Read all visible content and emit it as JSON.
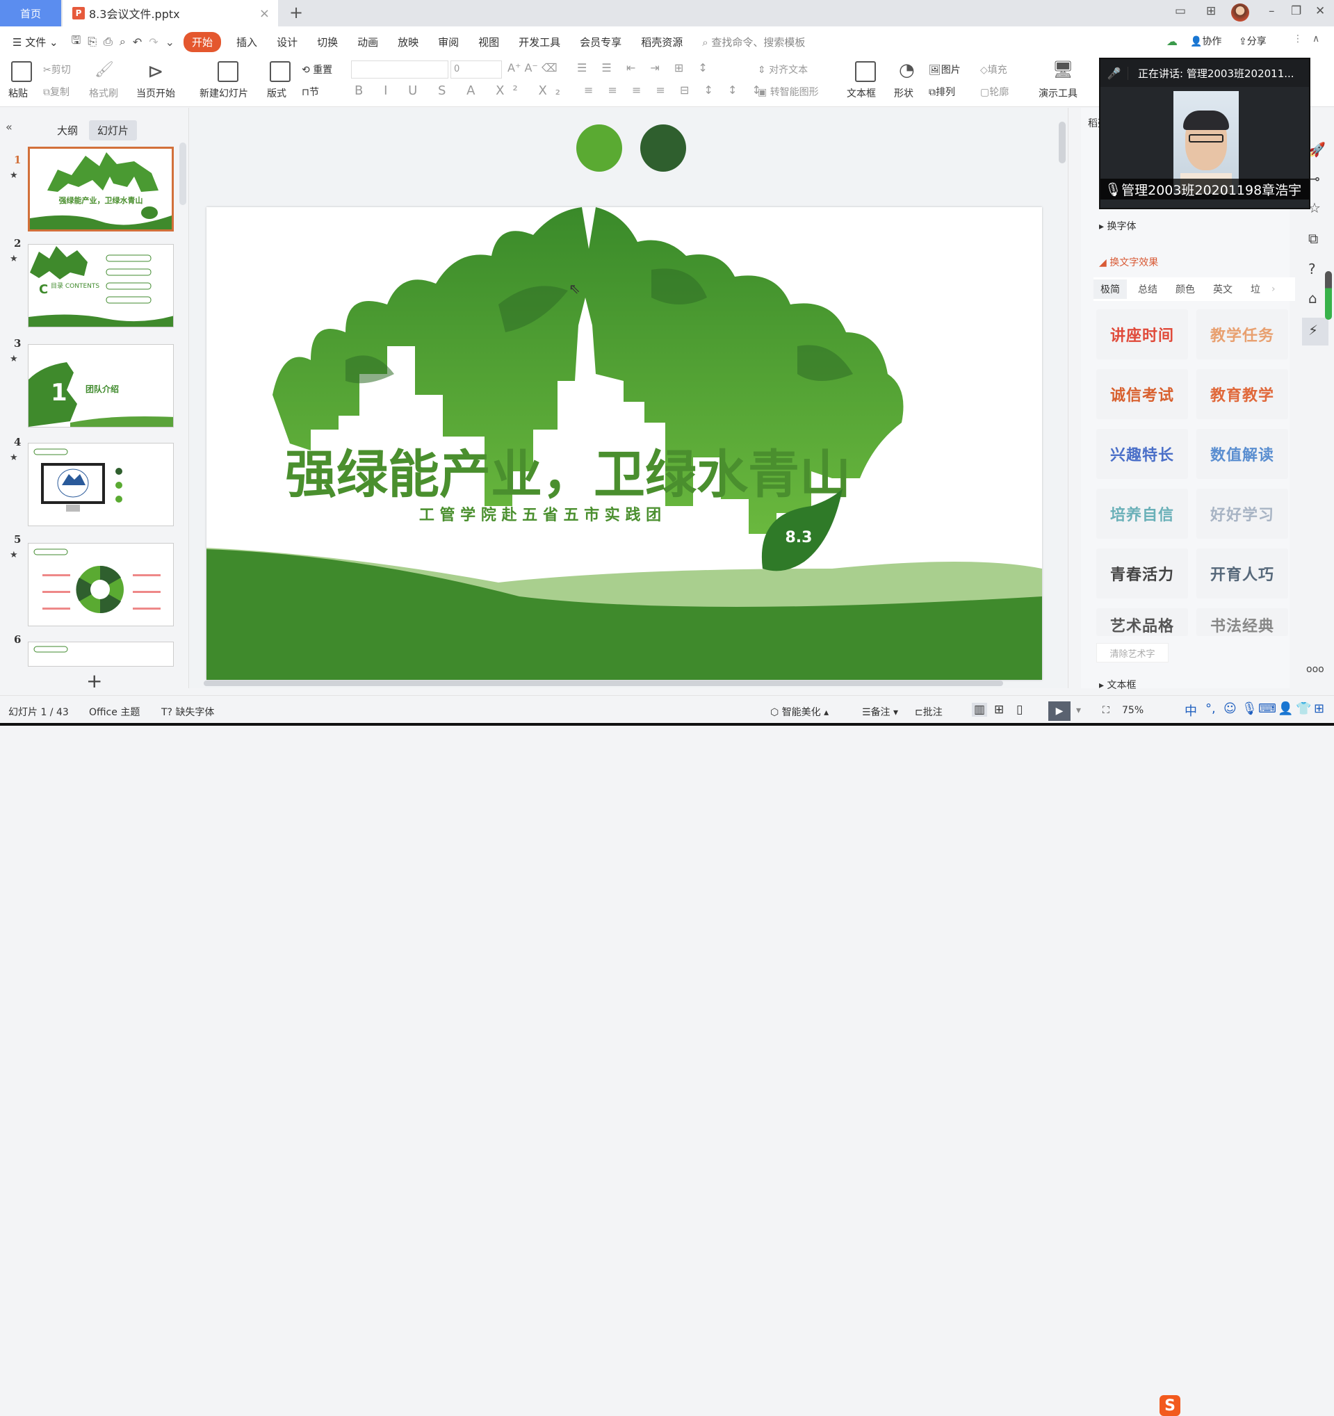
{
  "titlebar": {
    "home_tab": "首页",
    "doc_tab": "8.3会议文件.pptx",
    "doc_icon": "P",
    "close_tab": "×",
    "new_tab": "+",
    "window_controls": {
      "minimize": "–",
      "restore": "❐",
      "close": "✕"
    }
  },
  "menu": {
    "file": "文件",
    "tabs": [
      "开始",
      "插入",
      "设计",
      "切换",
      "动画",
      "放映",
      "审阅",
      "视图",
      "开发工具",
      "会员专享",
      "稻壳资源"
    ],
    "active_tab": "开始",
    "search_placeholder": "查找命令、搜索模板",
    "collab": "协作",
    "share": "分享"
  },
  "ribbon": {
    "paste": "粘贴",
    "cut": "剪切",
    "copy": "复制",
    "format_painter": "格式刷",
    "play_from_current": "当页开始",
    "new_slide": "新建幻灯片",
    "layout": "版式",
    "reset": "重置",
    "section": "节",
    "font_name": "",
    "font_size": "0",
    "align_text": "对齐文本",
    "smart_graphic": "转智能图形",
    "text_box": "文本框",
    "shape": "形状",
    "picture": "图片",
    "fill": "填充",
    "arrange": "排列",
    "outline": "轮廓",
    "presentation_tools": "演示工具"
  },
  "left_panel": {
    "tabs": [
      "大纲",
      "幻灯片"
    ],
    "active_tab": "幻灯片",
    "slides": [
      {
        "num": "1",
        "label": "强绿能产业，卫绿水青山",
        "selected": true
      },
      {
        "num": "2",
        "label": "目录 CONTENTS"
      },
      {
        "num": "3",
        "label": "团队介绍"
      },
      {
        "num": "4",
        "label": ""
      },
      {
        "num": "5",
        "label": ""
      },
      {
        "num": "6",
        "label": ""
      }
    ],
    "add_slide": "+"
  },
  "slide": {
    "title": "强绿能产业，卫绿水青山",
    "subtitle": "工 管 学 院 赴 五 省 五 市 实 践 团",
    "leaf_label": "8.3",
    "colors": {
      "light_green": "#5aaa32",
      "dark_green": "#2f5f2e",
      "title_green": "#4a8f2e"
    }
  },
  "right_panel": {
    "header": "稻壳",
    "missing": "缺",
    "sections": {
      "change_font": "换字体",
      "text_effect": "换文字效果",
      "text_box": "文本框"
    },
    "effect_tabs": [
      "极简",
      "总结",
      "颜色",
      "英文",
      "垃"
    ],
    "active_effect_tab": "极简",
    "effects": [
      {
        "text": "讲座时间",
        "color": "#e04a3a"
      },
      {
        "text": "教学任务",
        "color": "#e8a070"
      },
      {
        "text": "诚信考试",
        "color": "#d8602e"
      },
      {
        "text": "教育教学",
        "color": "#e0683a"
      },
      {
        "text": "兴趣特长",
        "color": "#4a6fc8"
      },
      {
        "text": "数值解读",
        "color": "#5a8ed0"
      },
      {
        "text": "培养自信",
        "color": "#6ab0b8"
      },
      {
        "text": "好好学习",
        "color": "#a8b4c4"
      },
      {
        "text": "青春活力",
        "color": "#444444"
      },
      {
        "text": "开育人巧",
        "color": "#56687a"
      },
      {
        "text": "艺术品格",
        "color": "#555555"
      },
      {
        "text": "书法经典",
        "color": "#888888"
      }
    ],
    "clear_art": "清除艺术字"
  },
  "video": {
    "speaking": "正在讲话: 管理2003班202011...",
    "name": "管理2003班20201198章浩宇"
  },
  "statusbar": {
    "slide_counter": "幻灯片 1 / 43",
    "theme": "Office 主题",
    "missing_font": "缺失字体",
    "beautify": "智能美化",
    "notes": "备注",
    "comment": "批注",
    "zoom": "75%",
    "ime_lang": "中"
  }
}
